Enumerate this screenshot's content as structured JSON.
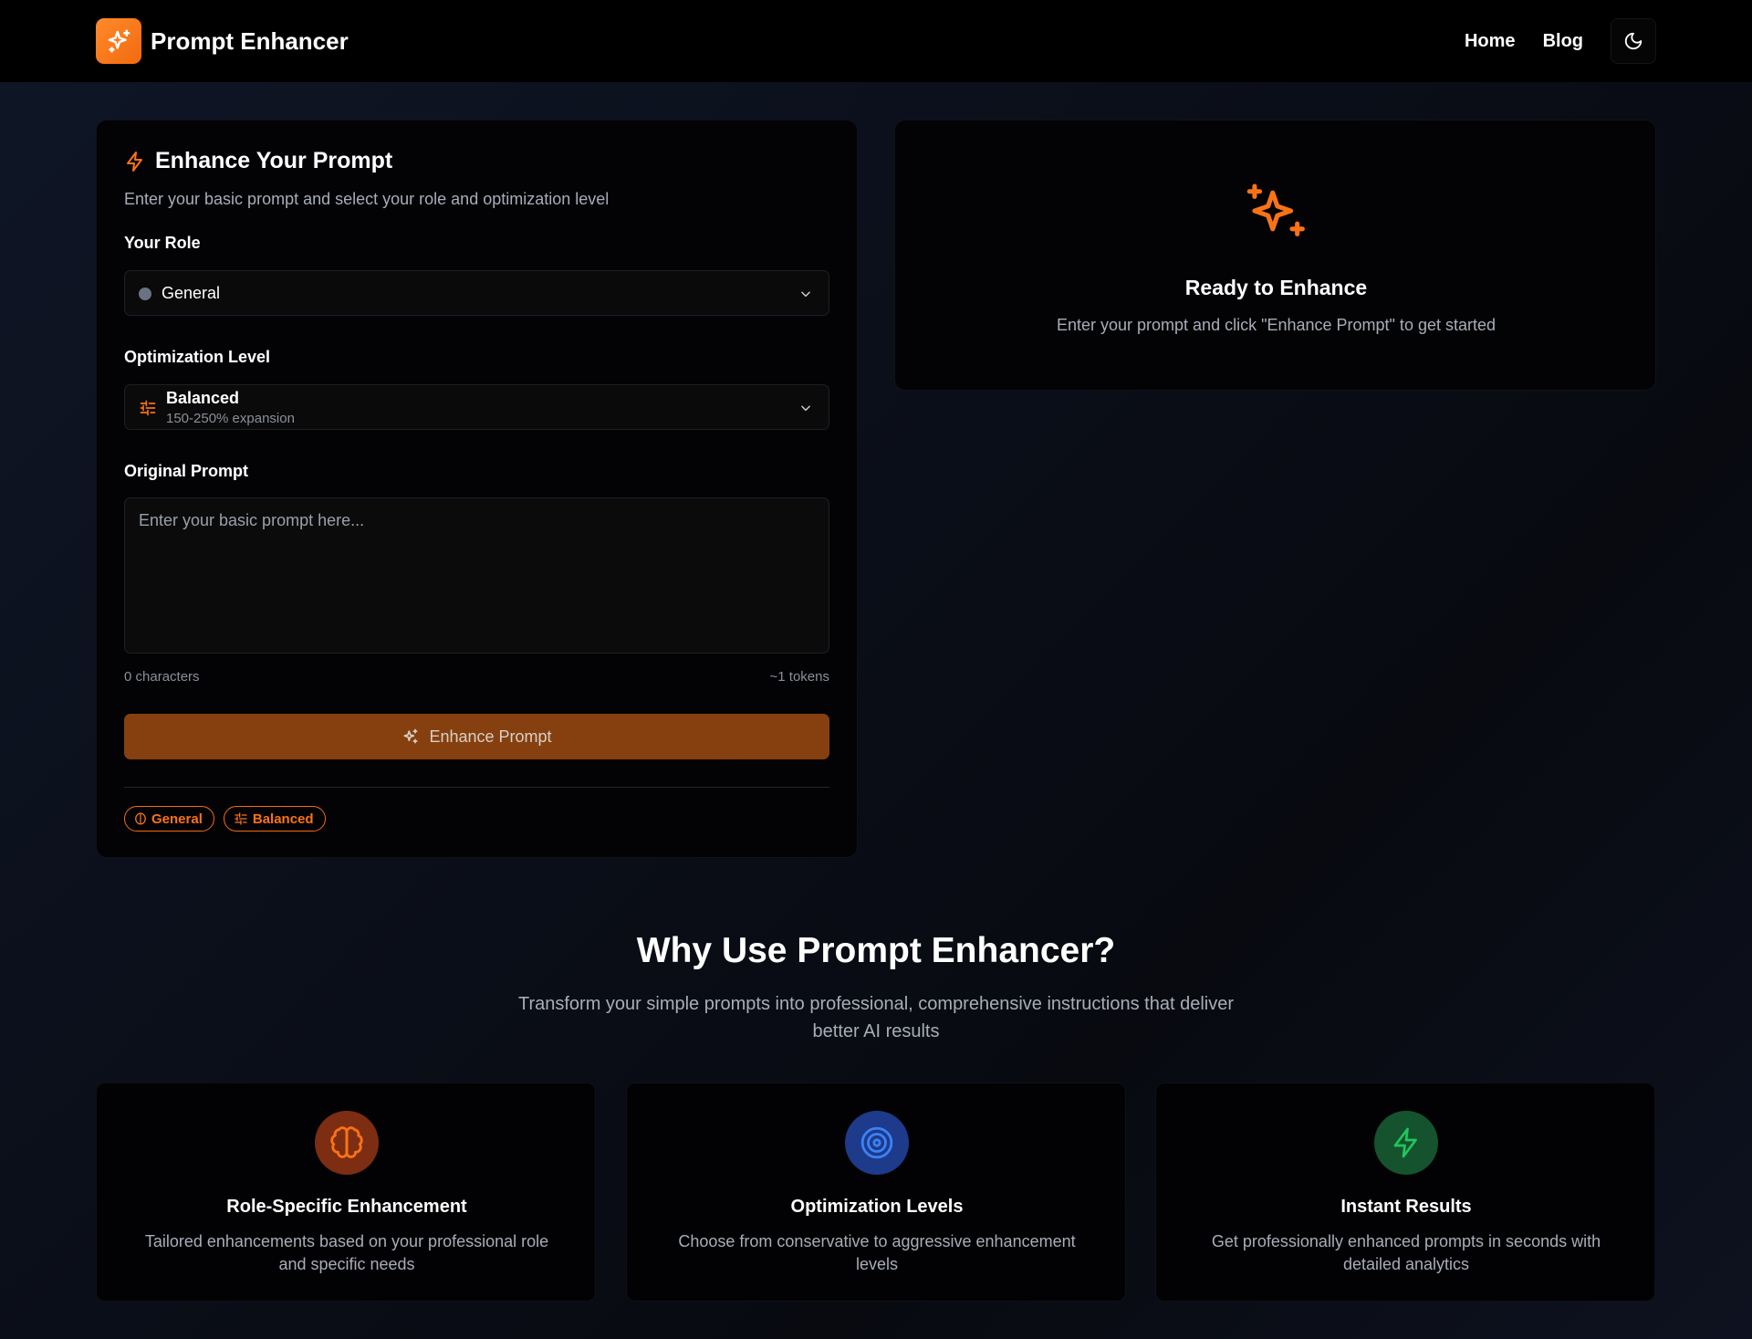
{
  "header": {
    "brand": "Prompt Enhancer",
    "nav": [
      "Home",
      "Blog"
    ]
  },
  "form": {
    "title": "Enhance Your Prompt",
    "subtitle": "Enter your basic prompt and select your role and optimization level",
    "role_label": "Your Role",
    "role_value": "General",
    "level_label": "Optimization Level",
    "level_value": "Balanced",
    "level_detail": "150-250% expansion",
    "prompt_label": "Original Prompt",
    "prompt_placeholder": "Enter your basic prompt here...",
    "prompt_value": "",
    "char_count": "0 characters",
    "token_count": "~1 tokens",
    "enhance_button": "Enhance Prompt",
    "badges": [
      "General",
      "Balanced"
    ]
  },
  "ready": {
    "title": "Ready to Enhance",
    "subtitle": "Enter your prompt and click \"Enhance Prompt\" to get started"
  },
  "why": {
    "title": "Why Use Prompt Enhancer?",
    "subtitle": "Transform your simple prompts into professional, comprehensive instructions that deliver better AI results",
    "features": [
      {
        "title": "Role-Specific Enhancement",
        "desc": "Tailored enhancements based on your professional role and specific needs",
        "icon": "brain-icon",
        "color": "#f97316"
      },
      {
        "title": "Optimization Levels",
        "desc": "Choose from conservative to aggressive enhancement levels",
        "icon": "target-icon",
        "color": "#3b82f6"
      },
      {
        "title": "Instant Results",
        "desc": "Get professionally enhanced prompts in seconds with detailed analytics",
        "icon": "zap-icon",
        "color": "#22c55e"
      }
    ]
  },
  "colors": {
    "accent": "#f97316",
    "button": "#86400f",
    "background": "#0b0f1a"
  }
}
